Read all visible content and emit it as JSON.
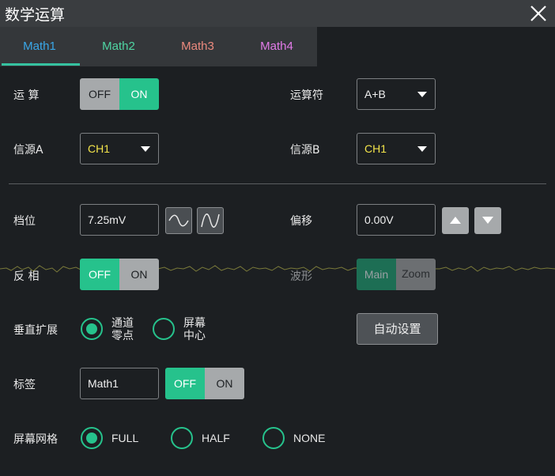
{
  "window": {
    "title": "数学运算"
  },
  "tabs": [
    {
      "label": "Math1",
      "color": "#3aa7e8",
      "active": true
    },
    {
      "label": "Math2",
      "color": "#4fd6a3"
    },
    {
      "label": "Math3",
      "color": "#ec8a7e"
    },
    {
      "label": "Math4",
      "color": "#e27be8"
    }
  ],
  "operation": {
    "label": "运 算",
    "off": "OFF",
    "on": "ON",
    "state": "ON"
  },
  "operator": {
    "label": "运算符",
    "value": "A+B"
  },
  "source_a": {
    "label": "信源A",
    "value": "CH1",
    "value_color": "#f2e34a"
  },
  "source_b": {
    "label": "信源B",
    "value": "CH1",
    "value_color": "#f2e34a"
  },
  "scale": {
    "label": "档位",
    "value": "7.25mV"
  },
  "offset": {
    "label": "偏移",
    "value": "0.00V"
  },
  "invert": {
    "label": "反 相",
    "off": "OFF",
    "on": "ON",
    "state": "OFF"
  },
  "waveform": {
    "label": "波形",
    "main": "Main",
    "zoom": "Zoom",
    "state": "Main"
  },
  "vertical_expand": {
    "label": "垂直扩展",
    "options": [
      {
        "line1": "通道",
        "line2": "零点",
        "selected": true
      },
      {
        "line1": "屏幕",
        "line2": "中心",
        "selected": false
      }
    ]
  },
  "auto_setup": {
    "label": "自动设置"
  },
  "tag": {
    "label": "标签",
    "value": "Math1",
    "off": "OFF",
    "on": "ON",
    "state": "OFF"
  },
  "grid": {
    "label": "屏幕网格",
    "options": [
      {
        "label": "FULL",
        "selected": true
      },
      {
        "label": "HALF",
        "selected": false
      },
      {
        "label": "NONE",
        "selected": false
      }
    ]
  },
  "colors": {
    "accent": "#26c28c",
    "tab_active": "#3aa7e8"
  }
}
